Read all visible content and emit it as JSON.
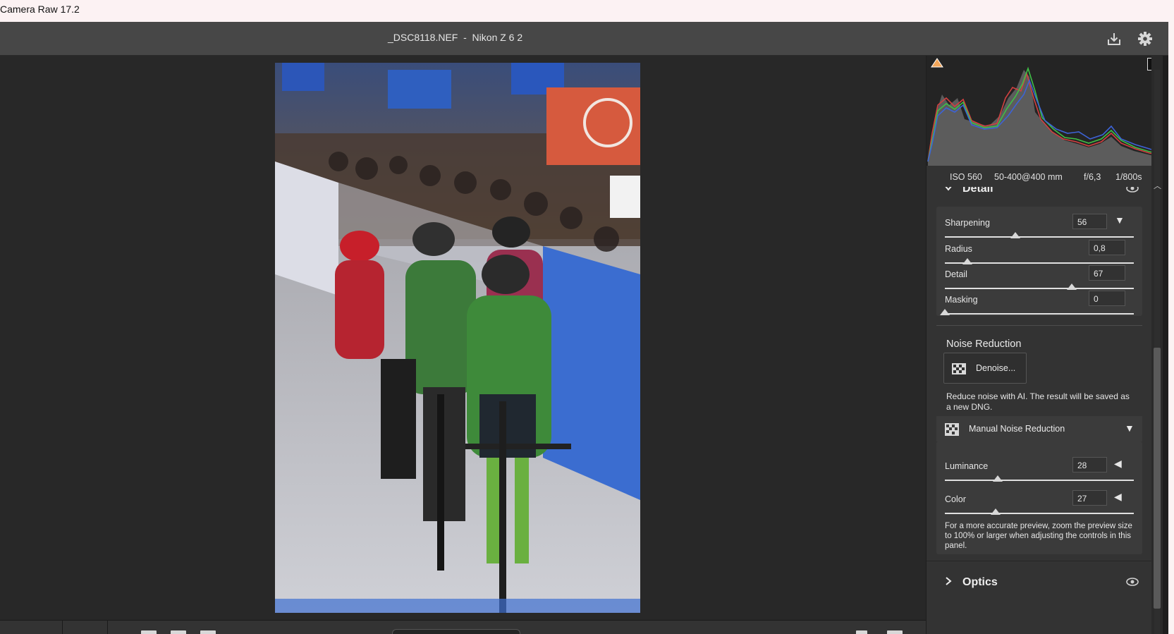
{
  "window": {
    "title": "Camera Raw 17.2"
  },
  "header": {
    "file_title": "_DSC8118.NEF  -  Nikon Z 6 2",
    "save_icon": "save-icon",
    "settings_icon": "gear-icon"
  },
  "exif": {
    "iso": "ISO 560",
    "lens": "50-400@400 mm",
    "aperture": "f/6,3",
    "shutter": "1/800s"
  },
  "detail": {
    "title": "Detail",
    "sliders": [
      {
        "label": "Sharpening",
        "value": "56",
        "min": 0,
        "max": 150,
        "numeric": 56
      },
      {
        "label": "Radius",
        "value": "0,8",
        "min": 0.5,
        "max": 3.0,
        "numeric": 0.8
      },
      {
        "label": "Detail",
        "value": "67",
        "min": 0,
        "max": 100,
        "numeric": 67
      },
      {
        "label": "Masking",
        "value": "0",
        "min": 0,
        "max": 100,
        "numeric": 0
      }
    ]
  },
  "noise_reduction": {
    "title": "Noise Reduction",
    "denoise_button": "Denoise...",
    "denoise_note": "Reduce noise with AI. The result will be saved as a new DNG.",
    "manual_label": "Manual Noise Reduction",
    "sliders": [
      {
        "label": "Luminance",
        "value": "28",
        "min": 0,
        "max": 100,
        "numeric": 28
      },
      {
        "label": "Color",
        "value": "27",
        "min": 0,
        "max": 100,
        "numeric": 27
      }
    ],
    "preview_note": "For a more accurate preview, zoom the preview size to 100% or larger when adjusting the controls in this panel."
  },
  "optics": {
    "title": "Optics"
  },
  "colors": {
    "accent_clip": "#f2a65a",
    "panel_bg": "#333333",
    "canvas_bg": "#282828"
  }
}
